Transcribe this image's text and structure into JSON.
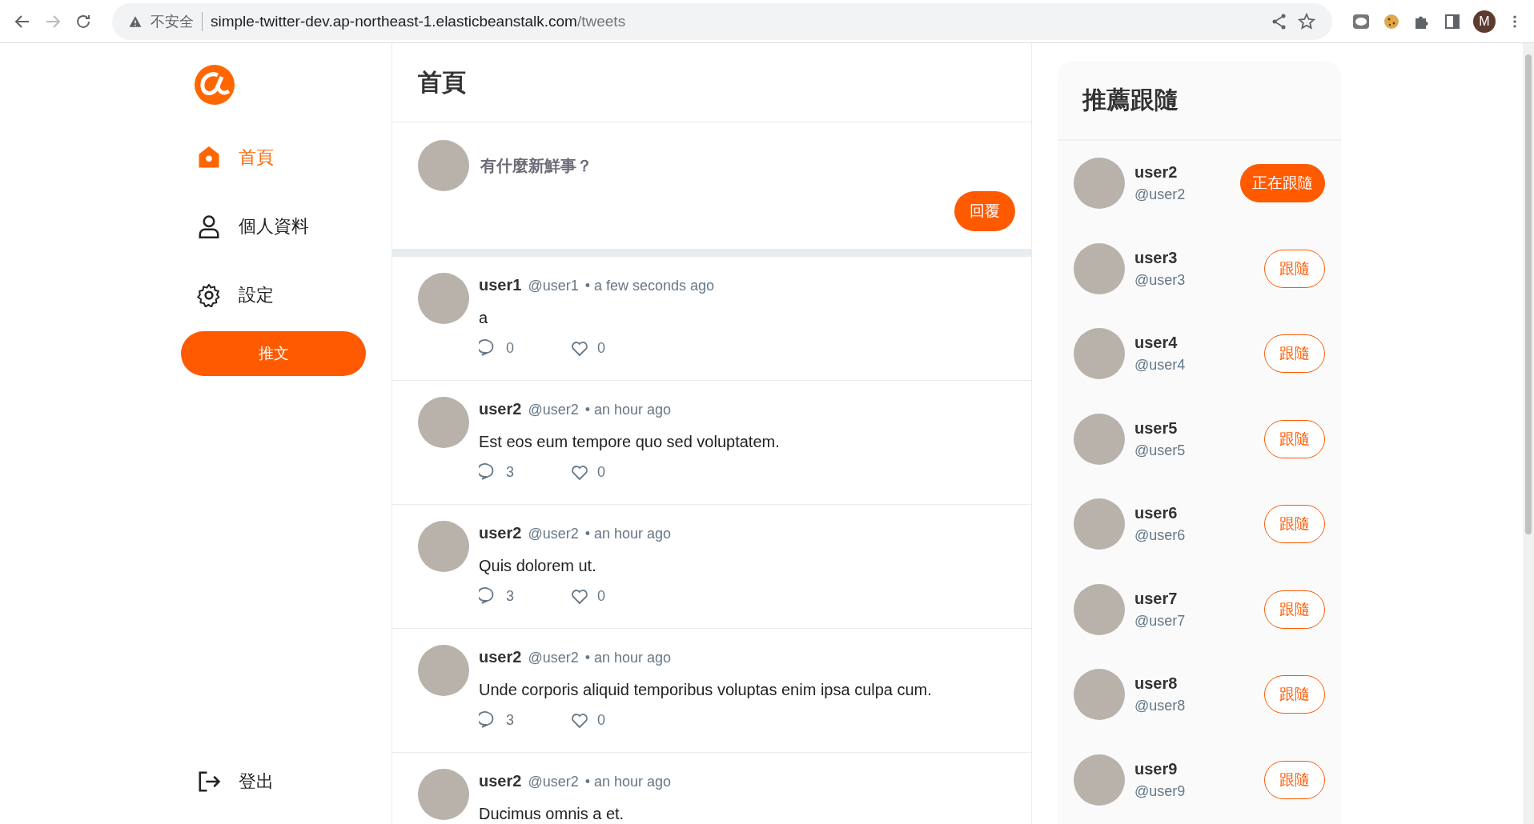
{
  "browser": {
    "security": "不安全",
    "url_host": "simple-twitter-dev.ap-northeast-1.elasticbeanstalk.com",
    "url_path": "/tweets",
    "profile_initial": "M"
  },
  "sidebar": {
    "items": [
      {
        "label": "首頁",
        "kind": "home",
        "selected": true
      },
      {
        "label": "個人資料",
        "kind": "profile",
        "selected": false
      },
      {
        "label": "設定",
        "kind": "settings",
        "selected": false
      }
    ],
    "tweet_button": "推文",
    "logout": "登出"
  },
  "main": {
    "title": "首頁",
    "composer": {
      "placeholder": "有什麼新鮮事？",
      "button": "回覆"
    },
    "tweets": [
      {
        "name": "user1",
        "handle": "@user1",
        "time": "• a few seconds ago",
        "text": "a",
        "replies": "0",
        "likes": "0"
      },
      {
        "name": "user2",
        "handle": "@user2",
        "time": "• an hour ago",
        "text": "Est eos eum tempore quo sed voluptatem.",
        "replies": "3",
        "likes": "0"
      },
      {
        "name": "user2",
        "handle": "@user2",
        "time": "• an hour ago",
        "text": "Quis dolorem ut.",
        "replies": "3",
        "likes": "0"
      },
      {
        "name": "user2",
        "handle": "@user2",
        "time": "• an hour ago",
        "text": "Unde corporis aliquid temporibus voluptas enim ipsa culpa cum.",
        "replies": "3",
        "likes": "0"
      },
      {
        "name": "user2",
        "handle": "@user2",
        "time": "• an hour ago",
        "text": "Ducimus omnis a et."
      }
    ]
  },
  "recommend": {
    "title": "推薦跟隨",
    "users": [
      {
        "name": "user2",
        "handle": "@user2",
        "button": "正在跟隨",
        "following": true
      },
      {
        "name": "user3",
        "handle": "@user3",
        "button": "跟隨",
        "following": false
      },
      {
        "name": "user4",
        "handle": "@user4",
        "button": "跟隨",
        "following": false
      },
      {
        "name": "user5",
        "handle": "@user5",
        "button": "跟隨",
        "following": false
      },
      {
        "name": "user6",
        "handle": "@user6",
        "button": "跟隨",
        "following": false
      },
      {
        "name": "user7",
        "handle": "@user7",
        "button": "跟隨",
        "following": false
      },
      {
        "name": "user8",
        "handle": "@user8",
        "button": "跟隨",
        "following": false
      },
      {
        "name": "user9",
        "handle": "@user9",
        "button": "跟隨",
        "following": false
      }
    ]
  }
}
